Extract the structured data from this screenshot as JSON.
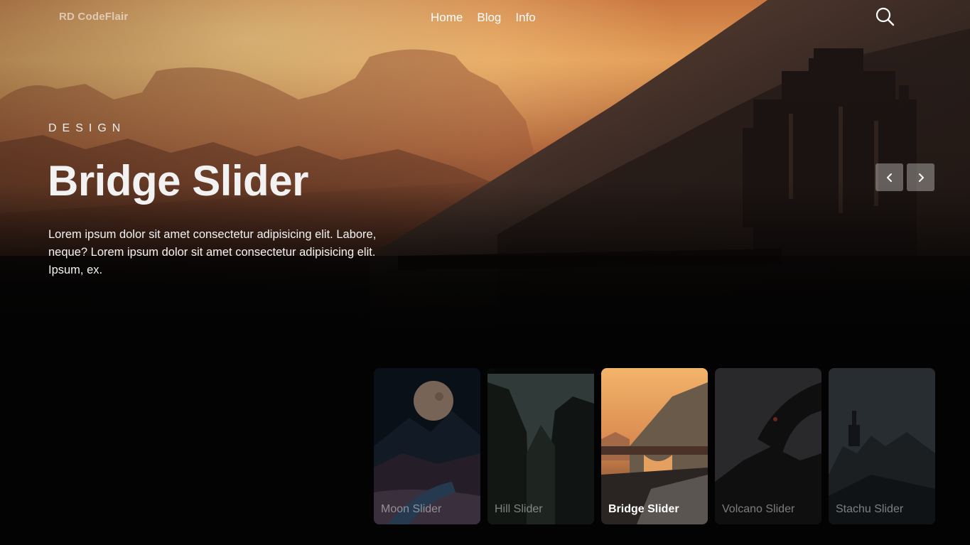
{
  "brand": {
    "logo_text": "RD CodeFlair"
  },
  "nav": {
    "items": [
      "Home",
      "Blog",
      "Info"
    ]
  },
  "hero": {
    "eyebrow": "DESIGN",
    "title": "Bridge Slider",
    "description": "Lorem ipsum dolor sit amet consectetur adipisicing elit. Labore, neque? Lorem ipsum dolor sit amet consectetur adipisicing elit. Ipsum, ex."
  },
  "controls": {
    "prev_icon": "chevron-left-icon",
    "next_icon": "chevron-right-icon",
    "search_icon": "search-icon"
  },
  "thumbnails": [
    {
      "label": "Moon Slider",
      "active": false
    },
    {
      "label": "Hill Slider",
      "active": false
    },
    {
      "label": "Bridge Slider",
      "active": true
    },
    {
      "label": "Volcano Slider",
      "active": false
    },
    {
      "label": "Stachu Slider",
      "active": false
    }
  ],
  "colors": {
    "background": "#030303",
    "sky_warm": "#e7a15a",
    "sky_glow": "#f6c17a",
    "arrow_bg": "#5a5551"
  }
}
